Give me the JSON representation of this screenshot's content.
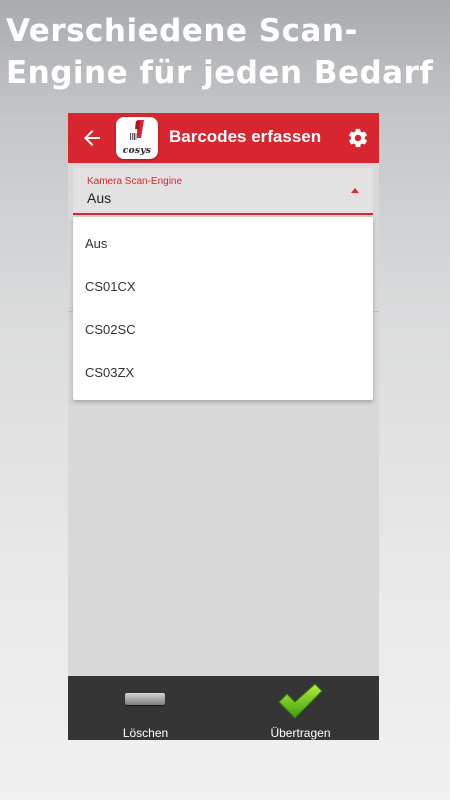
{
  "promo": {
    "line1": "Verschiedene Scan-",
    "line2": "Engine für jeden Bedarf"
  },
  "appbar": {
    "title": "Barcodes erfassen",
    "logo_text": "cosys",
    "back_icon": "arrow-left-icon",
    "settings_icon": "gear-icon",
    "color": "#d8252f"
  },
  "select": {
    "label": "Kamera Scan-Engine",
    "value": "Aus",
    "options": [
      "Aus",
      "CS01CX",
      "CS02SC",
      "CS03ZX"
    ]
  },
  "bottom_bar": {
    "delete_label": "Löschen",
    "transfer_label": "Übertragen"
  }
}
